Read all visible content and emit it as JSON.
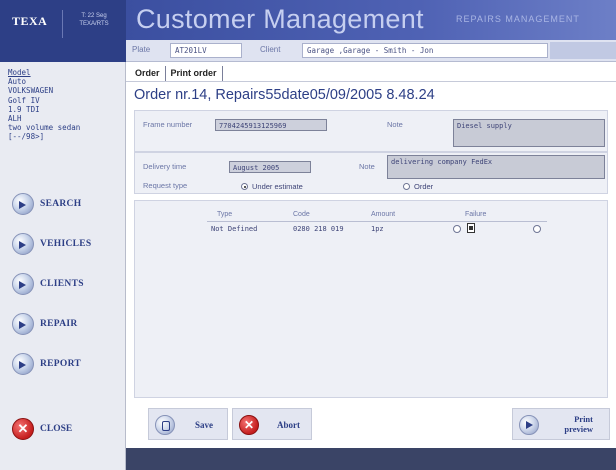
{
  "brand": {
    "logo": "TEXA",
    "subtitle": "T: 22 Seg TEXA/RTS"
  },
  "header": {
    "title": "Customer Management",
    "subtitle": "REPAIRS MANAGEMENT"
  },
  "plate_bar": {
    "plate_label": "Plate",
    "plate_value": "AT201LV",
    "client_label": "Client",
    "client_value": "Garage ,Garage - Smith - Jon"
  },
  "model": {
    "label": "Model",
    "lines": [
      "Auto",
      "VOLKSWAGEN",
      "Golf IV",
      "1.9 TDI",
      "ALH",
      "two volume sedan",
      "[--/98>]"
    ]
  },
  "sidebar": {
    "items": [
      {
        "label": "SEARCH",
        "icon": "arrow-icon"
      },
      {
        "label": "VEHICLES",
        "icon": "arrow-icon"
      },
      {
        "label": "CLIENTS",
        "icon": "arrow-icon"
      },
      {
        "label": "REPAIR",
        "icon": "arrow-icon"
      },
      {
        "label": "REPORT",
        "icon": "arrow-icon"
      }
    ],
    "close_label": "CLOSE"
  },
  "tabs": [
    "Order",
    "Print order"
  ],
  "order_title": "Order nr.14, Repairs55date05/09/2005 8.48.24",
  "form": {
    "frame_label": "Frame number",
    "frame_value": "7704245913125969",
    "note_label_1": "Note",
    "note_value_1": "Diesel supply",
    "delivery_label": "Delivery time",
    "delivery_value": "August 2005",
    "note_label_2": "Note",
    "note_value_2": "delivering company FedEx",
    "request_label": "Request type",
    "radio_estimate": "Under estimate",
    "radio_order": "Order",
    "selected": "Under estimate"
  },
  "table": {
    "headers": [
      "Type",
      "Code",
      "Amount",
      "Failure"
    ],
    "rows": [
      {
        "type": "Not Defined",
        "code": "0280 218 019",
        "amount": "1pz"
      }
    ]
  },
  "actions": {
    "save": "Save",
    "abort": "Abort",
    "print_preview": "Print preview"
  },
  "colors": {
    "accent": "#2d3f86",
    "header_bg": "#3b4fa0",
    "sidebar_bg": "#e9ebf2",
    "abort": "#c51e1e"
  }
}
